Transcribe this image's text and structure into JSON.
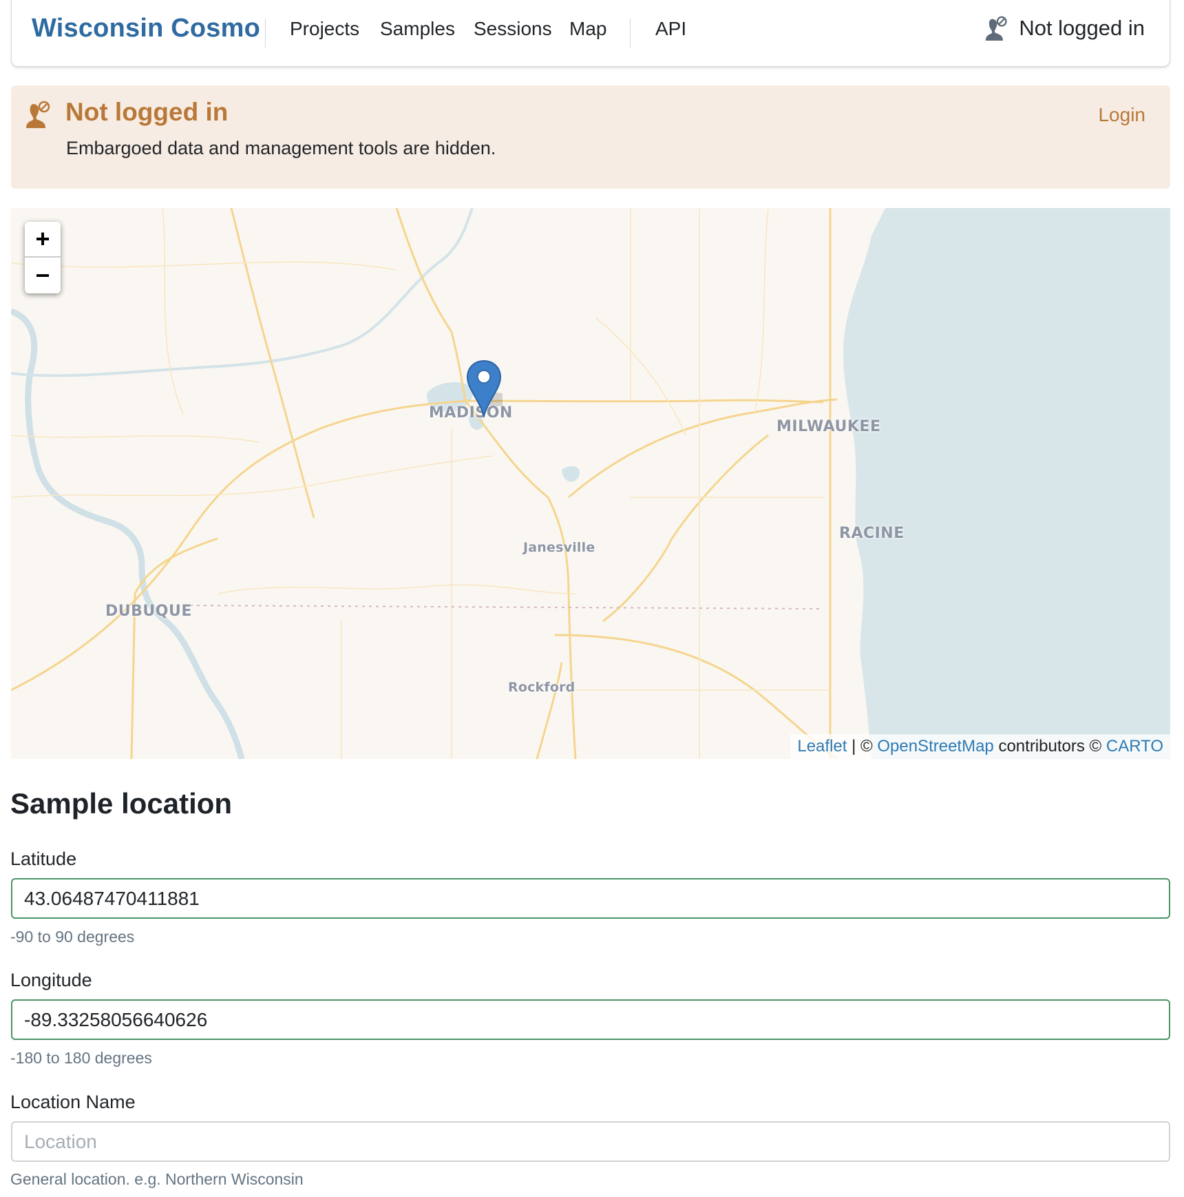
{
  "navbar": {
    "brand": "Wisconsin Cosmo",
    "links": [
      {
        "label": "Projects"
      },
      {
        "label": "Samples"
      },
      {
        "label": "Sessions"
      },
      {
        "label": "Map"
      },
      {
        "label": "API"
      }
    ],
    "user_status": "Not logged in",
    "user_icon": "user-slash-icon"
  },
  "alert": {
    "icon": "user-slash-icon",
    "title": "Not logged in",
    "message": "Embargoed data and management tools are hidden.",
    "login_label": "Login"
  },
  "map": {
    "zoom_in_label": "+",
    "zoom_out_label": "−",
    "cities": [
      {
        "name": "MADISON",
        "size": "big"
      },
      {
        "name": "MILWAUKEE",
        "size": "big"
      },
      {
        "name": "RACINE",
        "size": "big"
      },
      {
        "name": "DUBUQUE",
        "size": "big"
      },
      {
        "name": "Janesville",
        "size": "small"
      },
      {
        "name": "Rockford",
        "size": "small"
      }
    ],
    "marker_icon": "map-pin-icon",
    "attribution": {
      "leaflet": "Leaflet",
      "sep": " | © ",
      "osm": "OpenStreetMap",
      "contributors": " contributors © ",
      "carto": "CARTO"
    }
  },
  "form": {
    "title": "Sample location",
    "latitude": {
      "label": "Latitude",
      "value": "43.06487470411881",
      "help": "-90 to 90 degrees"
    },
    "longitude": {
      "label": "Longitude",
      "value": "-89.33258056640626",
      "help": "-180 to 180 degrees"
    },
    "location_name": {
      "label": "Location Name",
      "value": "",
      "placeholder": "Location",
      "help": "General location. e.g. Northern Wisconsin"
    }
  },
  "colors": {
    "brand": "#2f6aa0",
    "alert_bg": "#f7ece3",
    "alert_accent": "#b87838",
    "valid_border": "#4a9466",
    "marker": "#3d7fc8",
    "water": "#d8e6ea",
    "land": "#faf7f2",
    "road": "#f7d990"
  }
}
